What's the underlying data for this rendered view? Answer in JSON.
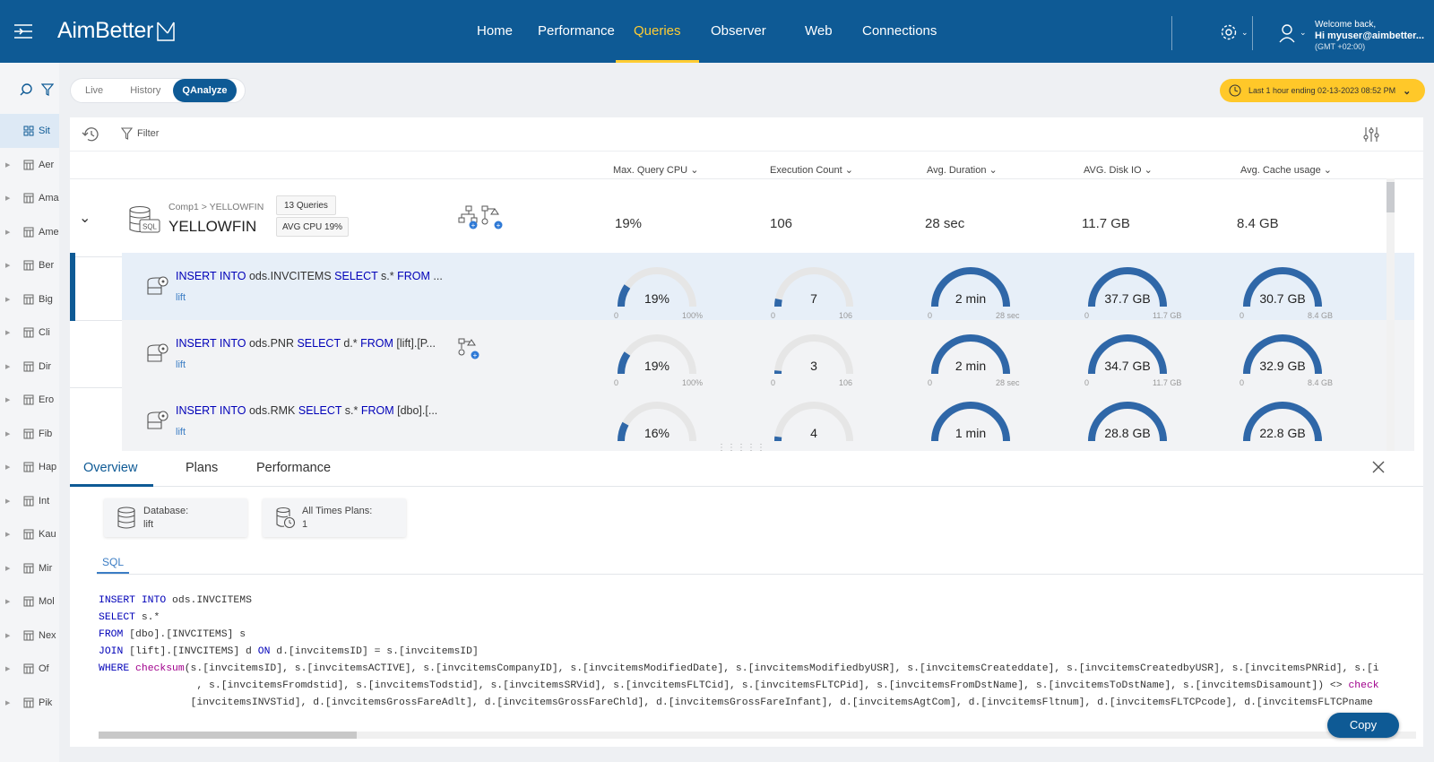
{
  "app": {
    "logo_text": "AimBetter"
  },
  "nav": [
    {
      "label": "Home"
    },
    {
      "label": "Performance"
    },
    {
      "label": "Queries"
    },
    {
      "label": "Observer"
    },
    {
      "label": "Web"
    },
    {
      "label": "Connections"
    }
  ],
  "nav_active": "Queries",
  "user": {
    "welcome": "Welcome back,",
    "name": "Hi myuser@aimbetter...",
    "timezone": "(GMT +02:00)"
  },
  "mode_tabs": [
    {
      "label": "Live"
    },
    {
      "label": "History"
    },
    {
      "label": "QAnalyze"
    }
  ],
  "mode_active": "QAnalyze",
  "time_range": "Last 1 hour ending  02-13-2023 08:52 PM",
  "filter_label": "Filter",
  "sidebar": [
    {
      "label": "Sit"
    },
    {
      "label": "Aer"
    },
    {
      "label": "Ama"
    },
    {
      "label": "Ame"
    },
    {
      "label": "Ber"
    },
    {
      "label": "Big"
    },
    {
      "label": "Cli"
    },
    {
      "label": "Dir"
    },
    {
      "label": "Ero"
    },
    {
      "label": "Fib"
    },
    {
      "label": "Hap"
    },
    {
      "label": "Int"
    },
    {
      "label": "Kau"
    },
    {
      "label": "Mir"
    },
    {
      "label": "Mol"
    },
    {
      "label": "Nex"
    },
    {
      "label": "Of"
    },
    {
      "label": "Pik"
    }
  ],
  "columns": [
    {
      "label": "Max. Query CPU"
    },
    {
      "label": "Execution Count"
    },
    {
      "label": "Avg. Duration"
    },
    {
      "label": "AVG. Disk IO"
    },
    {
      "label": "Avg. Cache usage"
    }
  ],
  "group": {
    "path": "Comp1 > YELLOWFIN",
    "name": "YELLOWFIN",
    "db_icon_label": "SQL",
    "queries_badge": "13 Queries",
    "cpu_badge": "AVG CPU 19%",
    "values": [
      "19%",
      "106",
      "28 sec",
      "11.7 GB",
      "8.4 GB"
    ]
  },
  "queries": [
    {
      "parts": [
        [
          "k",
          "INSERT INTO"
        ],
        [
          "t",
          " ods.INVCITEMS "
        ],
        [
          "k",
          "SELECT"
        ],
        [
          "t",
          " s.* "
        ],
        [
          "k",
          "FROM"
        ],
        [
          "t",
          " ..."
        ]
      ],
      "db": "lift",
      "has_plan_icon": false,
      "gauges": [
        {
          "label": "19%",
          "fraction": 0.19,
          "min": "0",
          "max": "100%"
        },
        {
          "label": "7",
          "fraction": 0.066,
          "min": "0",
          "max": "106"
        },
        {
          "label": "2 min",
          "fraction": 1,
          "min": "0",
          "max": "28 sec"
        },
        {
          "label": "37.7 GB",
          "fraction": 1,
          "min": "0",
          "max": "11.7 GB"
        },
        {
          "label": "30.7 GB",
          "fraction": 1,
          "min": "0",
          "max": "8.4 GB"
        }
      ]
    },
    {
      "parts": [
        [
          "k",
          "INSERT INTO"
        ],
        [
          "t",
          " ods.PNR "
        ],
        [
          "k",
          "SELECT"
        ],
        [
          "t",
          " d.* "
        ],
        [
          "k",
          "FROM"
        ],
        [
          "t",
          " [lift].[P..."
        ]
      ],
      "db": "lift",
      "has_plan_icon": true,
      "gauges": [
        {
          "label": "19%",
          "fraction": 0.19,
          "min": "0",
          "max": "100%"
        },
        {
          "label": "3",
          "fraction": 0.028,
          "min": "0",
          "max": "106"
        },
        {
          "label": "2 min",
          "fraction": 1,
          "min": "0",
          "max": "28 sec"
        },
        {
          "label": "34.7 GB",
          "fraction": 1,
          "min": "0",
          "max": "11.7 GB"
        },
        {
          "label": "32.9 GB",
          "fraction": 1,
          "min": "0",
          "max": "8.4 GB"
        }
      ]
    },
    {
      "parts": [
        [
          "k",
          "INSERT INTO"
        ],
        [
          "t",
          " ods.RMK "
        ],
        [
          "k",
          "SELECT"
        ],
        [
          "t",
          " s.* "
        ],
        [
          "k",
          "FROM"
        ],
        [
          "t",
          " [dbo].[..."
        ]
      ],
      "db": "lift",
      "has_plan_icon": false,
      "gauges": [
        {
          "label": "16%",
          "fraction": 0.16,
          "min": "",
          "max": ""
        },
        {
          "label": "4",
          "fraction": 0.038,
          "min": "",
          "max": ""
        },
        {
          "label": "1 min",
          "fraction": 1,
          "min": "",
          "max": ""
        },
        {
          "label": "28.8 GB",
          "fraction": 1,
          "min": "",
          "max": ""
        },
        {
          "label": "22.8 GB",
          "fraction": 1,
          "min": "",
          "max": ""
        }
      ]
    }
  ],
  "detail": {
    "tabs": [
      {
        "label": "Overview"
      },
      {
        "label": "Plans"
      },
      {
        "label": "Performance"
      }
    ],
    "active_tab": "Overview",
    "cards": [
      {
        "label": "Database:",
        "value": "lift"
      },
      {
        "label": "All Times Plans:",
        "value": "1"
      }
    ],
    "sql_tab": "SQL",
    "sql_lines": [
      [
        [
          "k",
          "INSERT INTO"
        ],
        [
          "t",
          " ods.INVCITEMS"
        ]
      ],
      [
        [
          "k",
          "SELECT"
        ],
        [
          "t",
          " s.*"
        ]
      ],
      [
        [
          "k",
          "FROM"
        ],
        [
          "t",
          " [dbo].[INVCITEMS] s"
        ]
      ],
      [
        [
          "k",
          "JOIN"
        ],
        [
          "t",
          " [lift].[INVCITEMS] d "
        ],
        [
          "k",
          "ON"
        ],
        [
          "t",
          " d.[invcitemsID] = s.[invcitemsID]"
        ]
      ],
      [
        [
          "k",
          "WHERE"
        ],
        [
          "t",
          " "
        ],
        [
          "f",
          "checksum"
        ],
        [
          "t",
          "(s.[invcitemsID], s.[invcitemsACTIVE], s.[invcitemsCompanyID], s.[invcitemsModifiedDate], s.[invcitemsModifiedbyUSR], s.[invcitemsCreateddate], s.[invcitemsCreatedbyUSR], s.[invcitemsPNRid], s.[i"
        ]
      ],
      [
        [
          "t",
          "                , s.[invcitemsFromdstid], s.[invcitemsTodstid], s.[invcitemsSRVid], s.[invcitemsFLTCid], s.[invcitemsFLTCPid], s.[invcitemsFromDstName], s.[invcitemsToDstName], s.[invcitemsDisamount]) <> "
        ],
        [
          "f",
          "check"
        ]
      ],
      [
        [
          "t",
          "               [invcitemsINVSTid], d.[invcitemsGrossFareAdlt], d.[invcitemsGrossFareChld], d.[invcitemsGrossFareInfant], d.[invcitemsAgtCom], d.[invcitemsFltnum], d.[invcitemsFLTCPcode], d.[invcitemsFLTCPname"
        ]
      ]
    ],
    "copy_label": "Copy"
  },
  "colors": {
    "brand": "#0e5a95",
    "accent": "#ffcc33",
    "gauge": "#2f67a8",
    "gauge_track": "#e6e6e6"
  }
}
